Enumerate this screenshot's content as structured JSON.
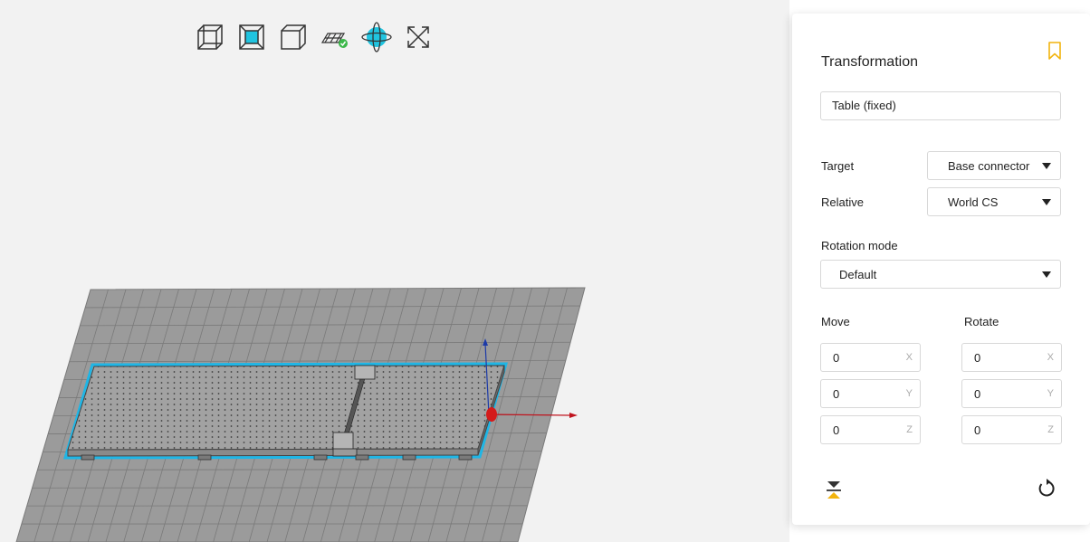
{
  "toolbar": {
    "icons": [
      "cube-wireframe-icon",
      "cube-front-filled-icon",
      "cube-outline-icon",
      "plane-check-icon",
      "orbit-globe-icon",
      "expand-arrows-icon"
    ]
  },
  "colors": {
    "accent": "#20c4e0",
    "bookmark": "#f2b40e",
    "floor": "#9b9b9b",
    "grid_line": "#7a7a7a",
    "selection_outline": "#1fb6e6",
    "axis_x": "#c0141e",
    "axis_y": "#1c3aa8",
    "check": "#3cb84a"
  },
  "panel": {
    "title": "Transformation",
    "object_name": "Table (fixed)",
    "target": {
      "label": "Target",
      "value": "Base connector"
    },
    "relative": {
      "label": "Relative",
      "value": "World CS"
    },
    "rotation_mode": {
      "label": "Rotation mode",
      "value": "Default"
    },
    "move": {
      "label": "Move",
      "fields": [
        {
          "value": "0",
          "axis": "X"
        },
        {
          "value": "0",
          "axis": "Y"
        },
        {
          "value": "0",
          "axis": "Z"
        }
      ]
    },
    "rotate": {
      "label": "Rotate",
      "fields": [
        {
          "value": "0",
          "axis": "X"
        },
        {
          "value": "0",
          "axis": "Y"
        },
        {
          "value": "0",
          "axis": "Z"
        }
      ]
    }
  }
}
